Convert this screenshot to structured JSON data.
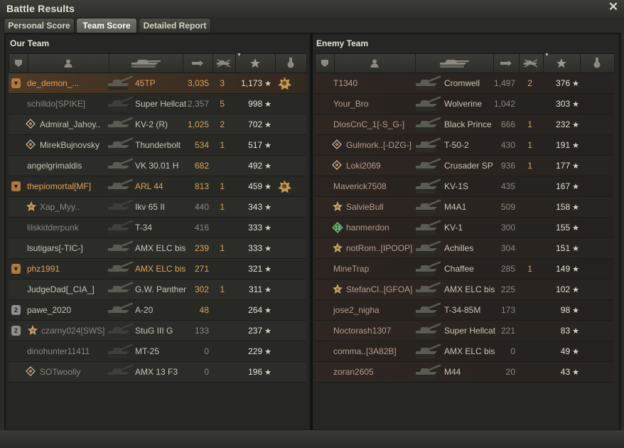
{
  "window": {
    "title": "Battle Results"
  },
  "tabs": [
    {
      "label": "Personal Score",
      "active": false
    },
    {
      "label": "Team Score",
      "active": true
    },
    {
      "label": "Detailed Report",
      "active": false
    }
  ],
  "our_team": {
    "title": "Our Team",
    "rows": [
      {
        "badge": "platoon",
        "mark": "",
        "name": "de_demon_...",
        "vehicle": "45TP",
        "damage": "3,035",
        "kills": "3",
        "xp": "1,173",
        "medal": true,
        "highlight": true,
        "style": "plat"
      },
      {
        "badge": "",
        "mark": "",
        "name": "schilldo[SPIKE]",
        "vehicle": "Super Hellcat",
        "damage": "2,357",
        "kills": "5",
        "xp": "998",
        "medal": false,
        "style": "dead"
      },
      {
        "badge": "",
        "mark": "diamond",
        "name": "Admiral_Jahoy..",
        "vehicle": "KV-2 (R)",
        "damage": "1,025",
        "kills": "2",
        "xp": "702",
        "medal": false,
        "style": ""
      },
      {
        "badge": "",
        "mark": "diamond",
        "name": "MirekBujnovsky",
        "vehicle": "Thunderbolt",
        "damage": "534",
        "kills": "1",
        "xp": "517",
        "medal": false,
        "style": ""
      },
      {
        "badge": "",
        "mark": "",
        "name": "angelgrimaldis",
        "vehicle": "VK 30.01 H",
        "damage": "682",
        "kills": "",
        "xp": "492",
        "medal": false,
        "style": ""
      },
      {
        "badge": "platoon",
        "mark": "",
        "name": "thepiomortal[MF]",
        "vehicle": "ARL 44",
        "damage": "813",
        "kills": "1",
        "xp": "459",
        "medal": true,
        "style": "plat"
      },
      {
        "badge": "",
        "mark": "star",
        "name": "Xap_Myy..",
        "vehicle": "Ikv 65 II",
        "damage": "440",
        "kills": "1",
        "xp": "343",
        "medal": false,
        "style": "dead"
      },
      {
        "badge": "",
        "mark": "",
        "name": "lilskidderpunk",
        "vehicle": "T-34",
        "damage": "416",
        "kills": "",
        "xp": "333",
        "medal": false,
        "style": "dead"
      },
      {
        "badge": "",
        "mark": "",
        "name": "lsutigars[-TIC-]",
        "vehicle": "AMX ELC bis",
        "damage": "239",
        "kills": "1",
        "xp": "333",
        "medal": false,
        "style": ""
      },
      {
        "badge": "platoon",
        "mark": "",
        "name": "phz1991",
        "vehicle": "AMX ELC bis",
        "damage": "271",
        "kills": "",
        "xp": "321",
        "medal": false,
        "style": "plat"
      },
      {
        "badge": "",
        "mark": "",
        "name": "JudgeDad[_CIA_]",
        "vehicle": "G.W. Panther",
        "damage": "302",
        "kills": "1",
        "xp": "311",
        "medal": false,
        "style": ""
      },
      {
        "badge": "p2",
        "mark": "",
        "name": "pawe_2020",
        "vehicle": "A-20",
        "damage": "48",
        "kills": "",
        "xp": "264",
        "medal": false,
        "style": ""
      },
      {
        "badge": "p2",
        "mark": "star",
        "name": "czarny024[SWS]",
        "vehicle": "StuG III G",
        "damage": "133",
        "kills": "",
        "xp": "237",
        "medal": false,
        "style": "dead"
      },
      {
        "badge": "",
        "mark": "",
        "name": "dinohunter11411",
        "vehicle": "MT-25",
        "damage": "0",
        "kills": "",
        "xp": "229",
        "medal": false,
        "style": "dead"
      },
      {
        "badge": "",
        "mark": "diamond",
        "name": "SOTwoolly",
        "vehicle": "AMX 13 F3",
        "damage": "0",
        "kills": "",
        "xp": "196",
        "medal": false,
        "style": "dead"
      }
    ]
  },
  "enemy_team": {
    "title": "Enemy Team",
    "rows": [
      {
        "mark": "",
        "name": "T1340",
        "vehicle": "Cromwell",
        "damage": "1,497",
        "kills": "2",
        "xp": "376"
      },
      {
        "mark": "",
        "name": "Your_Bro",
        "vehicle": "Wolverine",
        "damage": "1,042",
        "kills": "",
        "xp": "303"
      },
      {
        "mark": "",
        "name": "DiosCnC_1[-S_G-]",
        "vehicle": "Black Prince",
        "damage": "666",
        "kills": "1",
        "xp": "232"
      },
      {
        "mark": "diamond",
        "name": "Gulmork..[-DZG-]",
        "vehicle": "T-50-2",
        "damage": "430",
        "kills": "1",
        "xp": "191"
      },
      {
        "mark": "diamond",
        "name": "Loki2069",
        "vehicle": "Crusader SP",
        "damage": "936",
        "kills": "1",
        "xp": "177"
      },
      {
        "mark": "",
        "name": "Maverick7508",
        "vehicle": "KV-1S",
        "damage": "435",
        "kills": "",
        "xp": "167"
      },
      {
        "mark": "star",
        "name": "SalvieBull",
        "vehicle": "M4A1",
        "damage": "509",
        "kills": "",
        "xp": "158"
      },
      {
        "mark": "green",
        "name": "hanmerdon",
        "vehicle": "KV-1",
        "damage": "300",
        "kills": "",
        "xp": "155"
      },
      {
        "mark": "star",
        "name": "notRom..[IPOOP]",
        "vehicle": "Achilles",
        "damage": "304",
        "kills": "",
        "xp": "151"
      },
      {
        "mark": "",
        "name": "MineTrap",
        "vehicle": "Chaffee",
        "damage": "285",
        "kills": "1",
        "xp": "149"
      },
      {
        "mark": "star",
        "name": "StefanCl..[GFOA]",
        "vehicle": "AMX ELC bis",
        "damage": "225",
        "kills": "",
        "xp": "102"
      },
      {
        "mark": "",
        "name": "jose2_nigha",
        "vehicle": "T-34-85M",
        "damage": "173",
        "kills": "",
        "xp": "98"
      },
      {
        "mark": "",
        "name": "Noctorash1307",
        "vehicle": "Super Hellcat",
        "damage": "221",
        "kills": "",
        "xp": "83"
      },
      {
        "mark": "",
        "name": "comma..[3A82B]",
        "vehicle": "AMX ELC bis",
        "damage": "0",
        "kills": "",
        "xp": "49"
      },
      {
        "mark": "",
        "name": "zoran2605",
        "vehicle": "M44",
        "damage": "20",
        "kills": "",
        "xp": "43"
      }
    ]
  },
  "colors": {
    "accent": "#d8a55a",
    "platoon": "#e3a15a",
    "text": "#c9c5b6"
  },
  "icons": {
    "close": "close-icon",
    "columns": [
      "platoon-icon",
      "player-icon",
      "tank-icon",
      "damage-icon",
      "kills-icon",
      "xp-star-icon",
      "medal-icon"
    ]
  }
}
